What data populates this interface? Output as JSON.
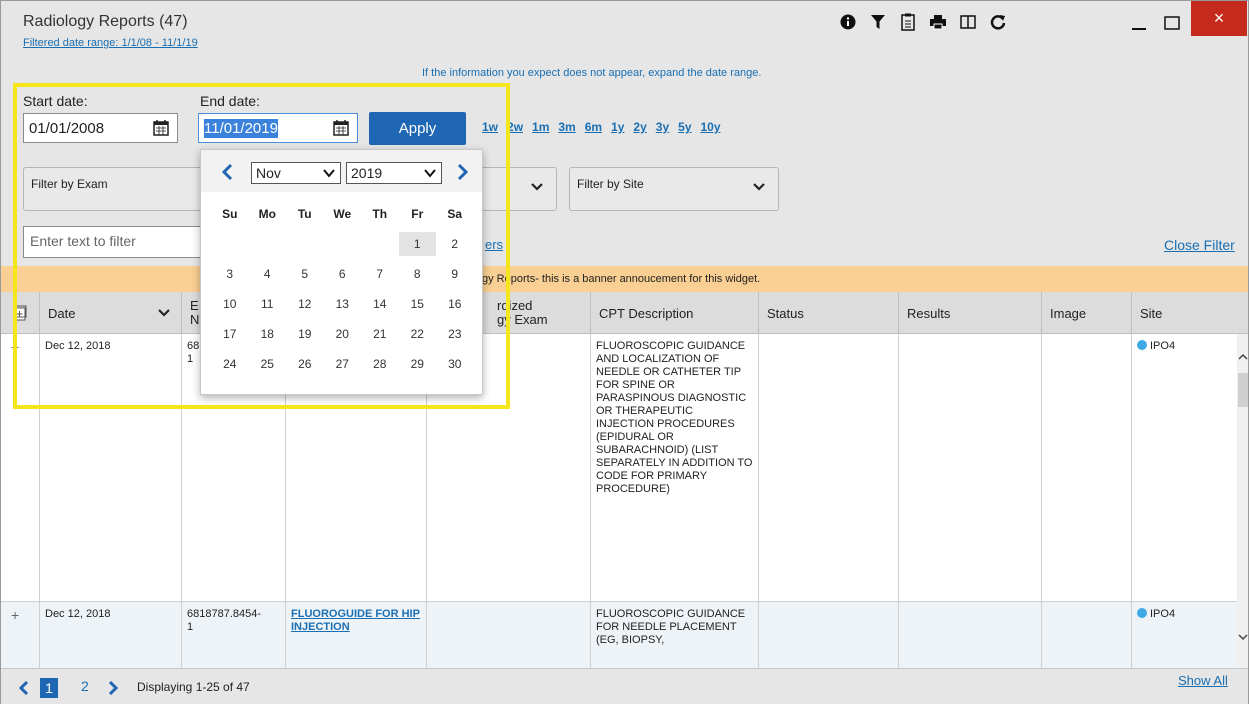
{
  "window": {
    "title": "Radiology Reports (47)",
    "filtered_range": "Filtered date range: 1/1/08 - 11/1/19",
    "date_hint": "If the information you expect does not appear, expand the date range.",
    "close_symbol": "×"
  },
  "toolbar": {
    "icons": [
      "info-icon",
      "filter-icon",
      "clipboard-icon",
      "print-icon",
      "columns-icon",
      "refresh-icon",
      "minimize-icon",
      "maximize-icon",
      "close-icon"
    ]
  },
  "dates": {
    "start_label": "Start date:",
    "start_value": "01/01/2008",
    "end_label": "End date:",
    "end_value": "11/01/2019",
    "apply_label": "Apply",
    "quick_ranges": [
      "1w",
      "2w",
      "1m",
      "3m",
      "6m",
      "1y",
      "2y",
      "3y",
      "5y",
      "10y"
    ]
  },
  "filters": {
    "exam_label": "Filter by Exam",
    "site_label": "Filter by Site",
    "text_placeholder": "Enter text to filter",
    "filters_link": "ers",
    "close_filter": "Close Filter"
  },
  "banner": {
    "text": "gy Reports- this is a banner annoucement for this widget."
  },
  "datepicker": {
    "month": "Nov",
    "year": "2019",
    "weekdays": [
      "Su",
      "Mo",
      "Tu",
      "We",
      "Th",
      "Fr",
      "Sa"
    ],
    "weeks": [
      [
        "",
        "",
        "",
        "",
        "",
        "1",
        "2"
      ],
      [
        "3",
        "4",
        "5",
        "6",
        "7",
        "8",
        "9"
      ],
      [
        "10",
        "11",
        "12",
        "13",
        "14",
        "15",
        "16"
      ],
      [
        "17",
        "18",
        "19",
        "20",
        "21",
        "22",
        "23"
      ],
      [
        "24",
        "25",
        "26",
        "27",
        "28",
        "29",
        "30"
      ]
    ],
    "selected_day": "1"
  },
  "table": {
    "headers": {
      "date": "Date",
      "exam_num_a": "E",
      "exam_num_b": "N",
      "std_exam_a": "rdized",
      "std_exam_b": "gy Exam",
      "cpt": "CPT Description",
      "status": "Status",
      "results": "Results",
      "image": "Image",
      "site": "Site"
    },
    "rows": [
      {
        "expand": "+",
        "date": "Dec 12, 2018",
        "exam_num_a": "68",
        "exam_num_b": "1",
        "exam": "",
        "cpt": "FLUOROSCOPIC GUIDANCE AND LOCALIZATION OF NEEDLE OR CATHETER TIP FOR SPINE OR PARASPINOUS DIAGNOSTIC OR THERAPEUTIC INJECTION PROCEDURES (EPIDURAL OR SUBARACHNOID) (LIST SEPARATELY IN ADDITION TO CODE FOR PRIMARY PROCEDURE)",
        "site": "IPO4"
      },
      {
        "expand": "+",
        "date": "Dec 12, 2018",
        "exam_num_a": "6818787.8454-",
        "exam_num_b": "1",
        "exam": "FLUOROGUIDE FOR HIP INJECTION",
        "cpt": "FLUOROSCOPIC GUIDANCE FOR NEEDLE PLACEMENT (EG, BIOPSY,",
        "site": "IPO4"
      }
    ]
  },
  "footer": {
    "page1": "1",
    "page2": "2",
    "displaying": "Displaying 1-25 of 47",
    "show_all": "Show All"
  },
  "colors": {
    "accent": "#1f67b4",
    "link": "#1a6fb3",
    "banner": "#f9cf93",
    "highlight": "#f4e61b",
    "close": "#c42b1c"
  }
}
